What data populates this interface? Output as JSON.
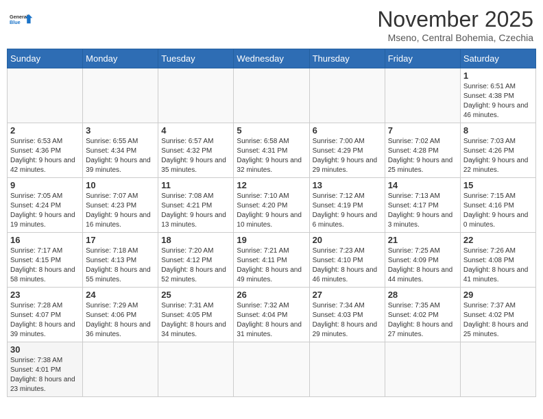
{
  "logo": {
    "text_general": "General",
    "text_blue": "Blue"
  },
  "header": {
    "month_year": "November 2025",
    "location": "Mseno, Central Bohemia, Czechia"
  },
  "weekdays": [
    "Sunday",
    "Monday",
    "Tuesday",
    "Wednesday",
    "Thursday",
    "Friday",
    "Saturday"
  ],
  "weeks": [
    [
      {
        "day": "",
        "info": ""
      },
      {
        "day": "",
        "info": ""
      },
      {
        "day": "",
        "info": ""
      },
      {
        "day": "",
        "info": ""
      },
      {
        "day": "",
        "info": ""
      },
      {
        "day": "",
        "info": ""
      },
      {
        "day": "1",
        "info": "Sunrise: 6:51 AM\nSunset: 4:38 PM\nDaylight: 9 hours and 46 minutes."
      }
    ],
    [
      {
        "day": "2",
        "info": "Sunrise: 6:53 AM\nSunset: 4:36 PM\nDaylight: 9 hours and 42 minutes."
      },
      {
        "day": "3",
        "info": "Sunrise: 6:55 AM\nSunset: 4:34 PM\nDaylight: 9 hours and 39 minutes."
      },
      {
        "day": "4",
        "info": "Sunrise: 6:57 AM\nSunset: 4:32 PM\nDaylight: 9 hours and 35 minutes."
      },
      {
        "day": "5",
        "info": "Sunrise: 6:58 AM\nSunset: 4:31 PM\nDaylight: 9 hours and 32 minutes."
      },
      {
        "day": "6",
        "info": "Sunrise: 7:00 AM\nSunset: 4:29 PM\nDaylight: 9 hours and 29 minutes."
      },
      {
        "day": "7",
        "info": "Sunrise: 7:02 AM\nSunset: 4:28 PM\nDaylight: 9 hours and 25 minutes."
      },
      {
        "day": "8",
        "info": "Sunrise: 7:03 AM\nSunset: 4:26 PM\nDaylight: 9 hours and 22 minutes."
      }
    ],
    [
      {
        "day": "9",
        "info": "Sunrise: 7:05 AM\nSunset: 4:24 PM\nDaylight: 9 hours and 19 minutes."
      },
      {
        "day": "10",
        "info": "Sunrise: 7:07 AM\nSunset: 4:23 PM\nDaylight: 9 hours and 16 minutes."
      },
      {
        "day": "11",
        "info": "Sunrise: 7:08 AM\nSunset: 4:21 PM\nDaylight: 9 hours and 13 minutes."
      },
      {
        "day": "12",
        "info": "Sunrise: 7:10 AM\nSunset: 4:20 PM\nDaylight: 9 hours and 10 minutes."
      },
      {
        "day": "13",
        "info": "Sunrise: 7:12 AM\nSunset: 4:19 PM\nDaylight: 9 hours and 6 minutes."
      },
      {
        "day": "14",
        "info": "Sunrise: 7:13 AM\nSunset: 4:17 PM\nDaylight: 9 hours and 3 minutes."
      },
      {
        "day": "15",
        "info": "Sunrise: 7:15 AM\nSunset: 4:16 PM\nDaylight: 9 hours and 0 minutes."
      }
    ],
    [
      {
        "day": "16",
        "info": "Sunrise: 7:17 AM\nSunset: 4:15 PM\nDaylight: 8 hours and 58 minutes."
      },
      {
        "day": "17",
        "info": "Sunrise: 7:18 AM\nSunset: 4:13 PM\nDaylight: 8 hours and 55 minutes."
      },
      {
        "day": "18",
        "info": "Sunrise: 7:20 AM\nSunset: 4:12 PM\nDaylight: 8 hours and 52 minutes."
      },
      {
        "day": "19",
        "info": "Sunrise: 7:21 AM\nSunset: 4:11 PM\nDaylight: 8 hours and 49 minutes."
      },
      {
        "day": "20",
        "info": "Sunrise: 7:23 AM\nSunset: 4:10 PM\nDaylight: 8 hours and 46 minutes."
      },
      {
        "day": "21",
        "info": "Sunrise: 7:25 AM\nSunset: 4:09 PM\nDaylight: 8 hours and 44 minutes."
      },
      {
        "day": "22",
        "info": "Sunrise: 7:26 AM\nSunset: 4:08 PM\nDaylight: 8 hours and 41 minutes."
      }
    ],
    [
      {
        "day": "23",
        "info": "Sunrise: 7:28 AM\nSunset: 4:07 PM\nDaylight: 8 hours and 39 minutes."
      },
      {
        "day": "24",
        "info": "Sunrise: 7:29 AM\nSunset: 4:06 PM\nDaylight: 8 hours and 36 minutes."
      },
      {
        "day": "25",
        "info": "Sunrise: 7:31 AM\nSunset: 4:05 PM\nDaylight: 8 hours and 34 minutes."
      },
      {
        "day": "26",
        "info": "Sunrise: 7:32 AM\nSunset: 4:04 PM\nDaylight: 8 hours and 31 minutes."
      },
      {
        "day": "27",
        "info": "Sunrise: 7:34 AM\nSunset: 4:03 PM\nDaylight: 8 hours and 29 minutes."
      },
      {
        "day": "28",
        "info": "Sunrise: 7:35 AM\nSunset: 4:02 PM\nDaylight: 8 hours and 27 minutes."
      },
      {
        "day": "29",
        "info": "Sunrise: 7:37 AM\nSunset: 4:02 PM\nDaylight: 8 hours and 25 minutes."
      }
    ],
    [
      {
        "day": "30",
        "info": "Sunrise: 7:38 AM\nSunset: 4:01 PM\nDaylight: 8 hours and 23 minutes."
      },
      {
        "day": "",
        "info": ""
      },
      {
        "day": "",
        "info": ""
      },
      {
        "day": "",
        "info": ""
      },
      {
        "day": "",
        "info": ""
      },
      {
        "day": "",
        "info": ""
      },
      {
        "day": "",
        "info": ""
      }
    ]
  ]
}
